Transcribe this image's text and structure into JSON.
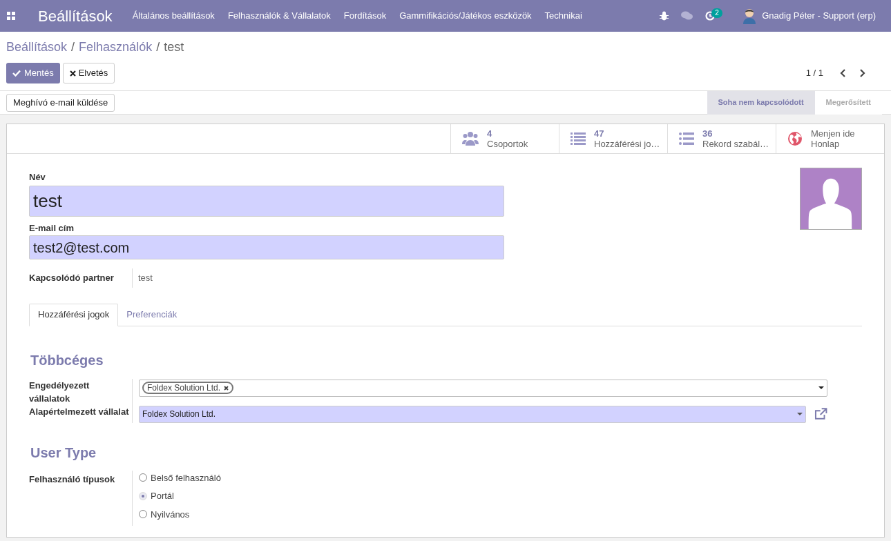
{
  "navbar": {
    "app_title": "Beállítások",
    "menu": [
      "Általános beállítások",
      "Felhasználók & Vállalatok",
      "Fordítások",
      "Gammifikációs/Játékos eszközök",
      "Technikai"
    ],
    "activity_count": "2",
    "user": "Gnadig Péter - Support (erp)"
  },
  "breadcrumb": {
    "items": [
      "Beállítások",
      "Felhasználók",
      "test"
    ],
    "separator": "/"
  },
  "buttons": {
    "save": "Mentés",
    "discard": "Elvetés"
  },
  "pager": "1 / 1",
  "action_button": "Meghívó e-mail küldése",
  "status_steps": [
    {
      "label": "Soha nem kapcsolódott",
      "selected": true
    },
    {
      "label": "Megerősített",
      "selected": false
    }
  ],
  "stat_buttons": [
    {
      "kind": "groups",
      "value": "4",
      "label": "Csoportok"
    },
    {
      "kind": "list",
      "value": "47",
      "label": "Hozzáférési jo…"
    },
    {
      "kind": "bullets",
      "value": "36",
      "label": "Rekord szabál…"
    },
    {
      "kind": "globe",
      "value": "Menjen ide",
      "label": "Honlap"
    }
  ],
  "name_field": {
    "label": "Név",
    "value": "test"
  },
  "email_field": {
    "label": "E-mail cím",
    "value": "test2@test.com"
  },
  "related_partner": {
    "label": "Kapcsolódó partner",
    "value": "test"
  },
  "tabs": [
    {
      "label": "Hozzáférési jogok",
      "selected": true
    },
    {
      "label": "Preferenciák",
      "selected": false
    }
  ],
  "multi_company": {
    "title": "Többcéges",
    "allowed_label": "Engedélyezett vállalatok",
    "allowed_tags": [
      "Foldex Solution Ltd."
    ],
    "default_label": "Alapértelmezett vállalat",
    "default_value": "Foldex Solution Ltd."
  },
  "user_type": {
    "title": "User Type",
    "label": "Felhasználó típusok",
    "options": [
      {
        "label": "Belső felhasználó",
        "selected": false
      },
      {
        "label": "Portál",
        "selected": true
      },
      {
        "label": "Nyilvános",
        "selected": false
      }
    ]
  }
}
